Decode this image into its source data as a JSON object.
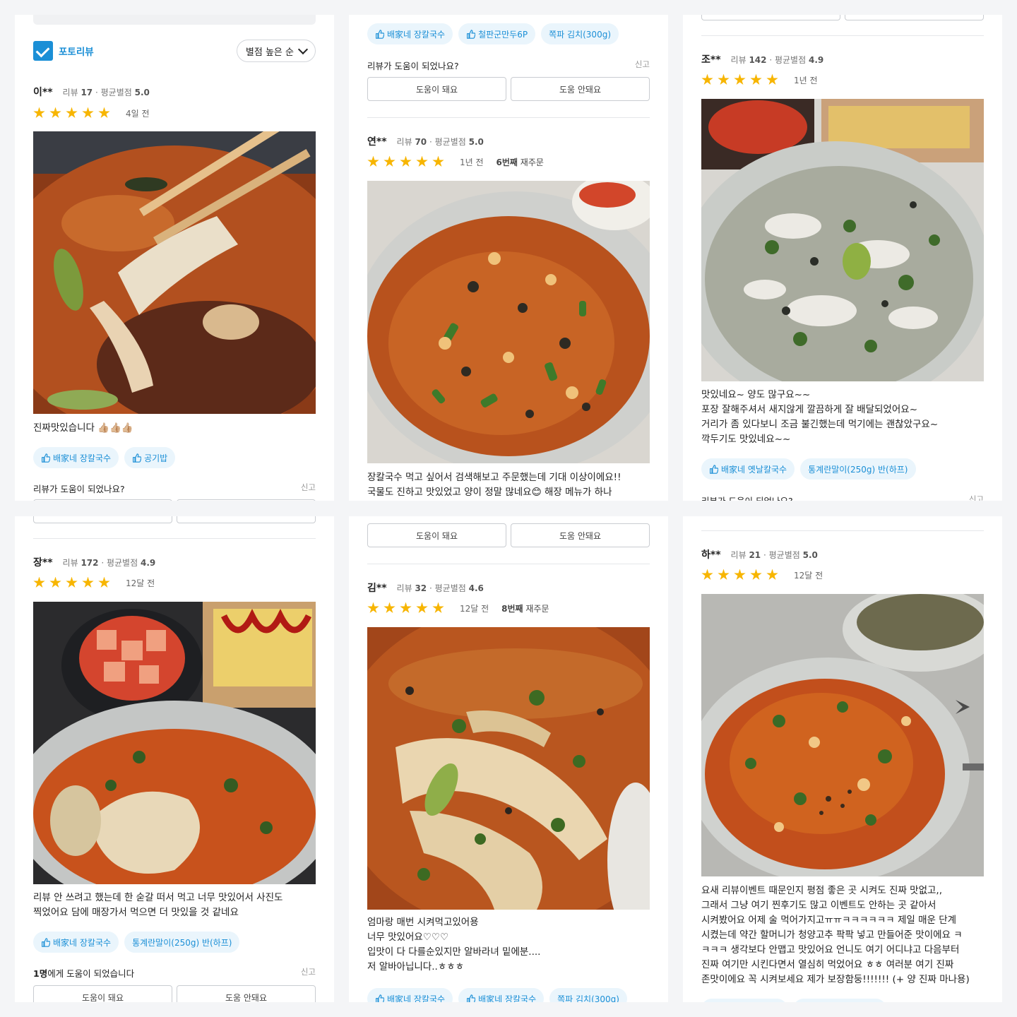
{
  "filter": {
    "photo_review_label": "포토리뷰",
    "sort_label": "별점 높은 순"
  },
  "common": {
    "helpful_question": "리뷰가 도움이 되었나요?",
    "report": "신고",
    "helpful_yes": "도움이 돼요",
    "helpful_no": "도움 안돼요"
  },
  "panels": {
    "p1": {
      "name": "이**",
      "meta_prefix": "리뷰",
      "review_count": "17",
      "avg_prefix": "· 평균별점",
      "avg": "5.0",
      "ago": "4일 전",
      "rating": 5,
      "text": "진짜맛있습니다 👍🏼👍🏼👍🏼",
      "tags": [
        "배家네 장칼국수",
        "공기밥"
      ]
    },
    "p2": {
      "top_tags": [
        "배家네 장칼국수",
        "철판군만두6P",
        "쪽파 김치(300g)"
      ],
      "name": "연**",
      "meta_prefix": "리뷰",
      "review_count": "70",
      "avg_prefix": "· 평균별점",
      "avg": "5.0",
      "ago": "1년 전",
      "reorder_bold": "6번째",
      "reorder_rest": " 재주문",
      "rating": 5,
      "text": "장칼국수 먹고 싶어서 검색해보고 주문했는데 기대 이상이에요!!\n국물도 진하고 맛있었고 양이 정말 많네요😊 해장 메뉴가 하나"
    },
    "p3": {
      "name": "조**",
      "meta_prefix": "리뷰",
      "review_count": "142",
      "avg_prefix": "· 평균별점",
      "avg": "4.9",
      "ago": "1년 전",
      "rating": 5,
      "text": "맛있네요~ 양도 많구요~~\n포장 잘해주셔서 새지않게 깔끔하게 잘 배달되었어요~\n거리가 좀 있다보니 조금 불긴했는데 먹기에는 괜찮았구요~\n깍두기도 맛있네요~~",
      "tags": [
        "배家네 옛날칼국수",
        "통계란말이(250g) 반(하프)"
      ]
    },
    "p4": {
      "name": "장**",
      "meta_prefix": "리뷰",
      "review_count": "172",
      "avg_prefix": "· 평균별점",
      "avg": "4.9",
      "ago": "12달 전",
      "rating": 5,
      "text": "리뷰 안 쓰려고 했는데 한 숟갈 떠서 먹고 너무 맛있어서 사진도\n찍었어요 담에 매장가서 먹으면 더 맛있을 것 같네요",
      "tags": [
        "배家네 장칼국수",
        "통계란말이(250g) 반(하프)"
      ],
      "helped_bold": "1명",
      "helped_rest": "에게 도움이 되었습니다"
    },
    "p5": {
      "name": "김**",
      "meta_prefix": "리뷰",
      "review_count": "32",
      "avg_prefix": "· 평균별점",
      "avg": "4.6",
      "ago": "12달 전",
      "reorder_bold": "8번째",
      "reorder_rest": " 재주문",
      "rating": 5,
      "text": "엄마랑 매번 시켜먹고있어용\n너무 맛있어요♡♡♡\n입맛이 다 다를순있지만 알바라녀 밑에분....\n저 알바아닙니다..ㅎㅎㅎ",
      "tags": [
        "배家네 장칼국수",
        "배家네 장칼국수",
        "쪽파 김치(300g)"
      ]
    },
    "p6": {
      "name": "하**",
      "meta_prefix": "리뷰",
      "review_count": "21",
      "avg_prefix": "· 평균별점",
      "avg": "5.0",
      "ago": "12달 전",
      "rating": 5,
      "text": "요새 리뷰이벤트 때문인지 평점 좋은 곳 시켜도 진짜 맛없고,,\n그래서 그냥 여기 찐후기도 많고 이벤트도 안하는 곳 같아서\n시켜봤어요 어제 술 먹어가지고ㅠㅠㅋㅋㅋㅋㅋㅋ 제일 매운 단계\n시켰는데 약간 할머니가 청양고추 팍팍 넣고 만들어준 맛이에요 ㅋ\nㅋㅋㅋ 생각보다 안맵고 맛있어요 언니도 여기 어디냐고 다음부터\n진짜 여기만 시킨다면서 열심히 먹었어요 ㅎㅎ 여러분 여기 진짜\n존맛이에요 꼭 시켜보세요 제가 보장함둥!!!!!!! (+ 양 진짜 마나용)"
    }
  }
}
